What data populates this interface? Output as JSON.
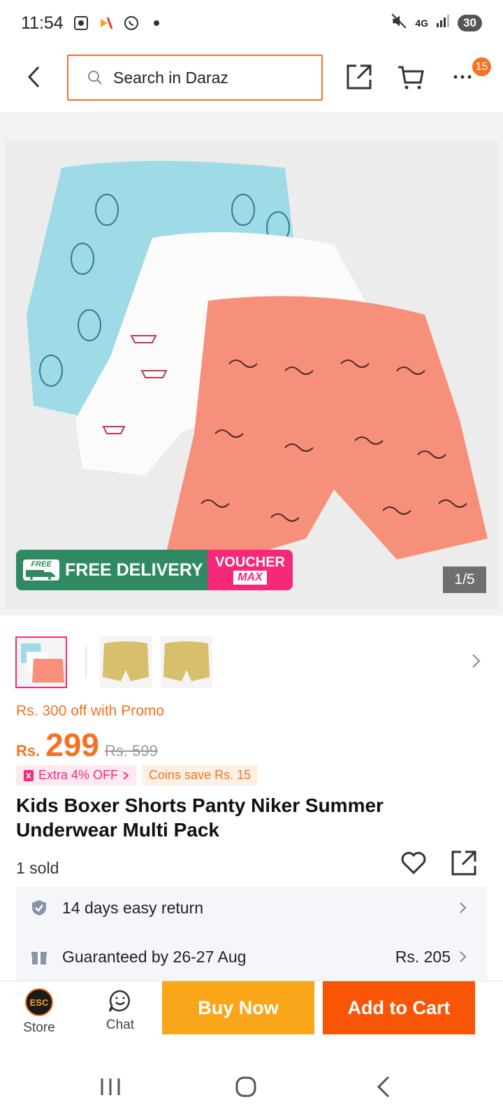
{
  "status_bar": {
    "time": "11:54",
    "battery": "30",
    "network": "4G"
  },
  "header": {
    "search_placeholder": "Search in Daraz",
    "more_badge": "15"
  },
  "gallery": {
    "page_indicator": "1/5",
    "promo_free_delivery": "FREE DELIVERY",
    "promo_free_tag": "FREE",
    "promo_voucher": "VOUCHER",
    "promo_voucher_max": "MAX",
    "thumbnail_count": 3,
    "selected_thumbnail": 1
  },
  "price": {
    "promo_line": "Rs. 300 off with Promo",
    "currency": "Rs.",
    "amount": "299",
    "original": "Rs. 599",
    "extra_off": "Extra 4% OFF",
    "coins_save": "Coins save Rs. 15"
  },
  "product": {
    "title": "Kids Boxer Shorts Panty Niker Summer Underwear Multi Pack",
    "sold": "1 sold"
  },
  "services": {
    "return_label": "14 days easy return",
    "delivery_label": "Guaranteed by 26-27 Aug",
    "delivery_fee": "Rs. 205"
  },
  "actions": {
    "store_label": "Store",
    "store_logo": "ESC",
    "chat_label": "Chat",
    "buy_now": "Buy Now",
    "add_to_cart": "Add to Cart"
  },
  "colors": {
    "brand_orange": "#f57224",
    "buy_yellow": "#faa61a",
    "cart_orange": "#f85606",
    "pink": "#f5287a",
    "delivery_green": "#2f8a63"
  }
}
